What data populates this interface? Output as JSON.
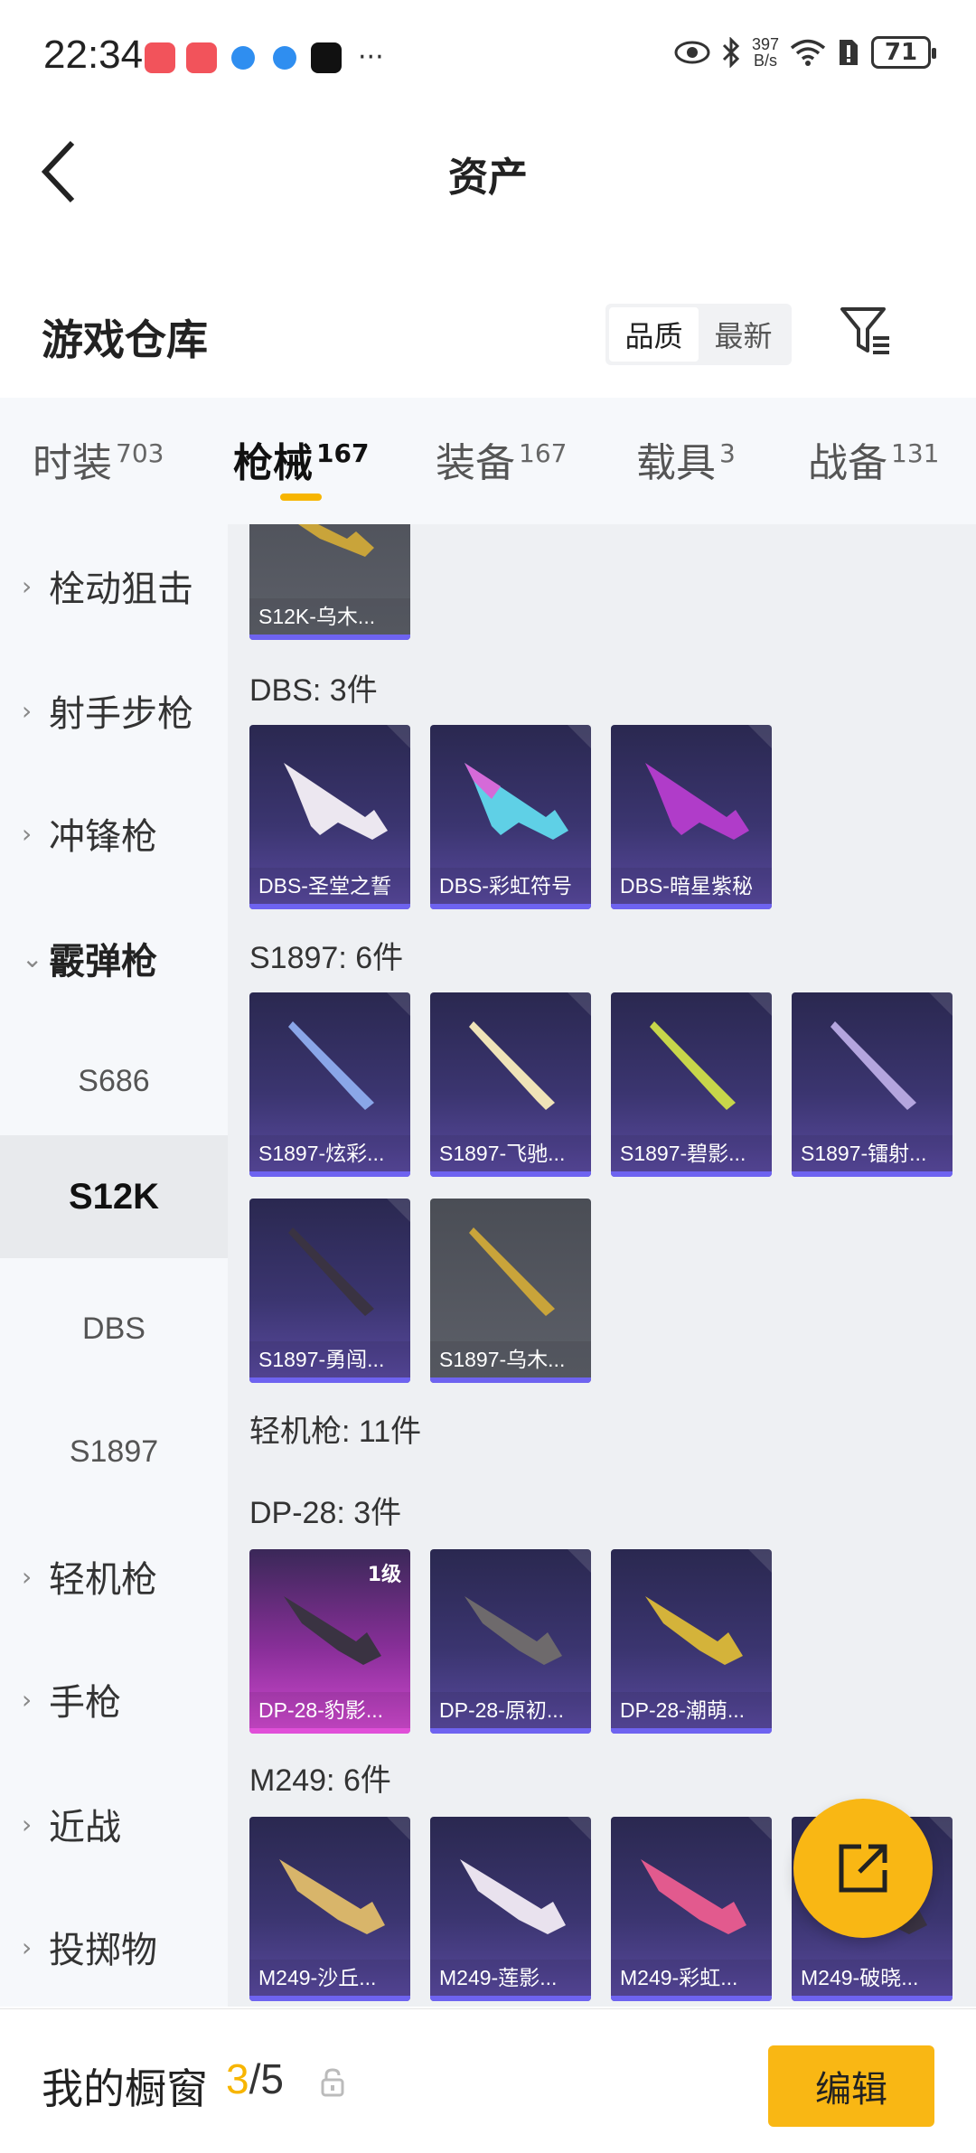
{
  "status_bar": {
    "time": "22:34",
    "net_speed_value": "397",
    "net_speed_unit": "B/s",
    "battery": "71"
  },
  "header": {
    "title": "资产"
  },
  "warehouse": {
    "title": "游戏仓库",
    "sort_options": [
      "品质",
      "最新"
    ],
    "sort_active": "品质"
  },
  "tabs": [
    {
      "label": "时装",
      "count": "703"
    },
    {
      "label": "枪械",
      "count": "167",
      "active": true
    },
    {
      "label": "装备",
      "count": "167"
    },
    {
      "label": "载具",
      "count": "3"
    },
    {
      "label": "战备",
      "count": "131"
    }
  ],
  "sidebar": {
    "items": [
      {
        "label": "栓动狙击"
      },
      {
        "label": "射手步枪"
      },
      {
        "label": "冲锋枪"
      },
      {
        "label": "霰弹枪",
        "expanded": true
      },
      {
        "label": "S686"
      },
      {
        "label": "S12K",
        "active": true
      },
      {
        "label": "DBS"
      },
      {
        "label": "S1897"
      },
      {
        "label": "轻机枪"
      },
      {
        "label": "手枪"
      },
      {
        "label": "近战"
      },
      {
        "label": "投掷物"
      }
    ]
  },
  "content": {
    "partial_card": {
      "label": "S12K-乌木..."
    },
    "sections": [
      {
        "title": "DBS: 3件",
        "cards": [
          "DBS-圣堂之誓",
          "DBS-彩虹符号",
          "DBS-暗星紫秘"
        ]
      },
      {
        "title": "S1897: 6件",
        "cards": [
          "S1897-炫彩...",
          "S1897-飞驰...",
          "S1897-碧影...",
          "S1897-镭射...",
          "S1897-勇闯...",
          "S1897-乌木..."
        ]
      },
      {
        "title": "轻机枪: 11件"
      },
      {
        "title": "DP-28: 3件",
        "cards": [
          "DP-28-豹影...",
          "DP-28-原初...",
          "DP-28-潮萌..."
        ],
        "first_card_level": "1级"
      },
      {
        "title": "M249: 6件",
        "cards": [
          "M249-沙丘...",
          "M249-莲影...",
          "M249-彩虹...",
          "M249-破晓..."
        ]
      }
    ]
  },
  "bottom_bar": {
    "title": "我的橱窗",
    "current": "3",
    "total": "/5",
    "edit_label": "编辑"
  },
  "colors": {
    "accent": "#f9b714",
    "tab_indicator": "#f7b500",
    "card_bar": "#6e63f0"
  }
}
